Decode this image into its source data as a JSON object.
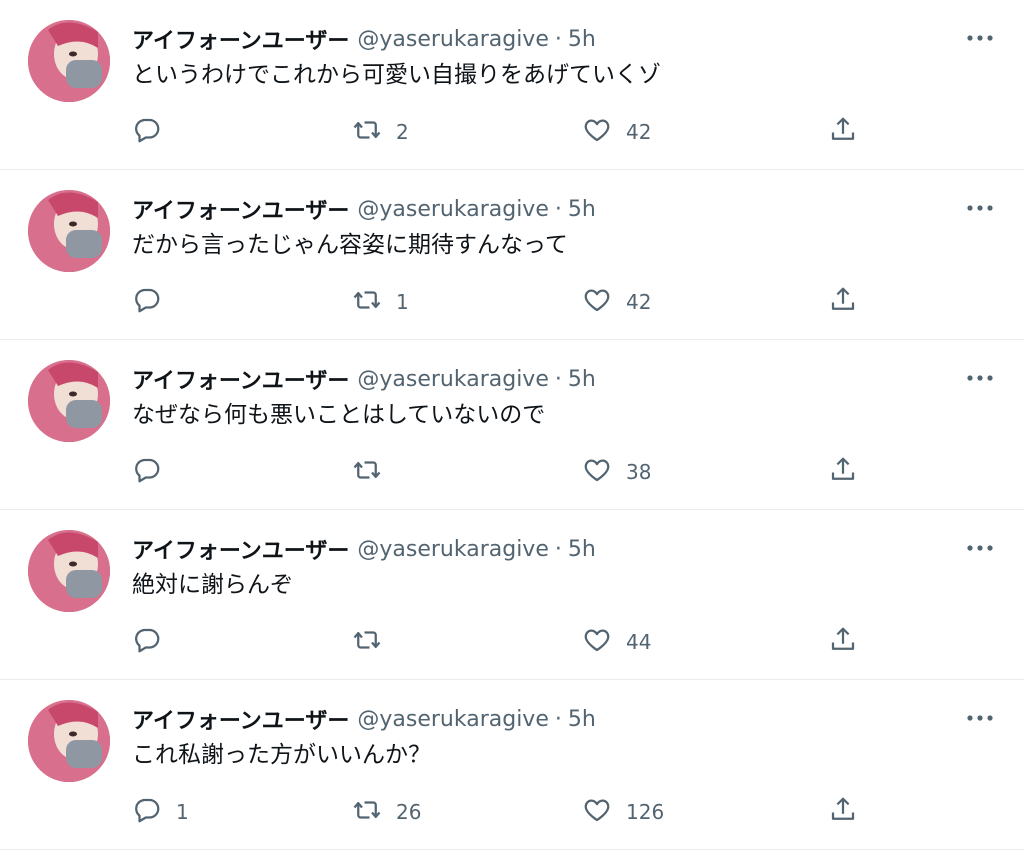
{
  "tweets": [
    {
      "author": "アイフォーンユーザー",
      "handle": "@yaserukaragive",
      "separator": "·",
      "time": "5h",
      "text": "というわけでこれから可愛い自撮りをあげていくゾ",
      "replies": "",
      "retweets": "2",
      "likes": "42"
    },
    {
      "author": "アイフォーンユーザー",
      "handle": "@yaserukaragive",
      "separator": "·",
      "time": "5h",
      "text": "だから言ったじゃん容姿に期待すんなって",
      "replies": "",
      "retweets": "1",
      "likes": "42"
    },
    {
      "author": "アイフォーンユーザー",
      "handle": "@yaserukaragive",
      "separator": "·",
      "time": "5h",
      "text": "なぜなら何も悪いことはしていないので",
      "replies": "",
      "retweets": "",
      "likes": "38"
    },
    {
      "author": "アイフォーンユーザー",
      "handle": "@yaserukaragive",
      "separator": "·",
      "time": "5h",
      "text": "絶対に謝らんぞ",
      "replies": "",
      "retweets": "",
      "likes": "44"
    },
    {
      "author": "アイフォーンユーザー",
      "handle": "@yaserukaragive",
      "separator": "·",
      "time": "5h",
      "text": "これ私謝った方がいいんか？",
      "replies": "1",
      "retweets": "26",
      "likes": "126"
    }
  ],
  "icons": {
    "reply": "reply-icon",
    "retweet": "retweet-icon",
    "like": "heart-icon",
    "share": "share-icon",
    "more": "more-icon"
  },
  "colors": {
    "text": "#0f1419",
    "secondary": "#536471",
    "divider": "#e6ecf0"
  }
}
